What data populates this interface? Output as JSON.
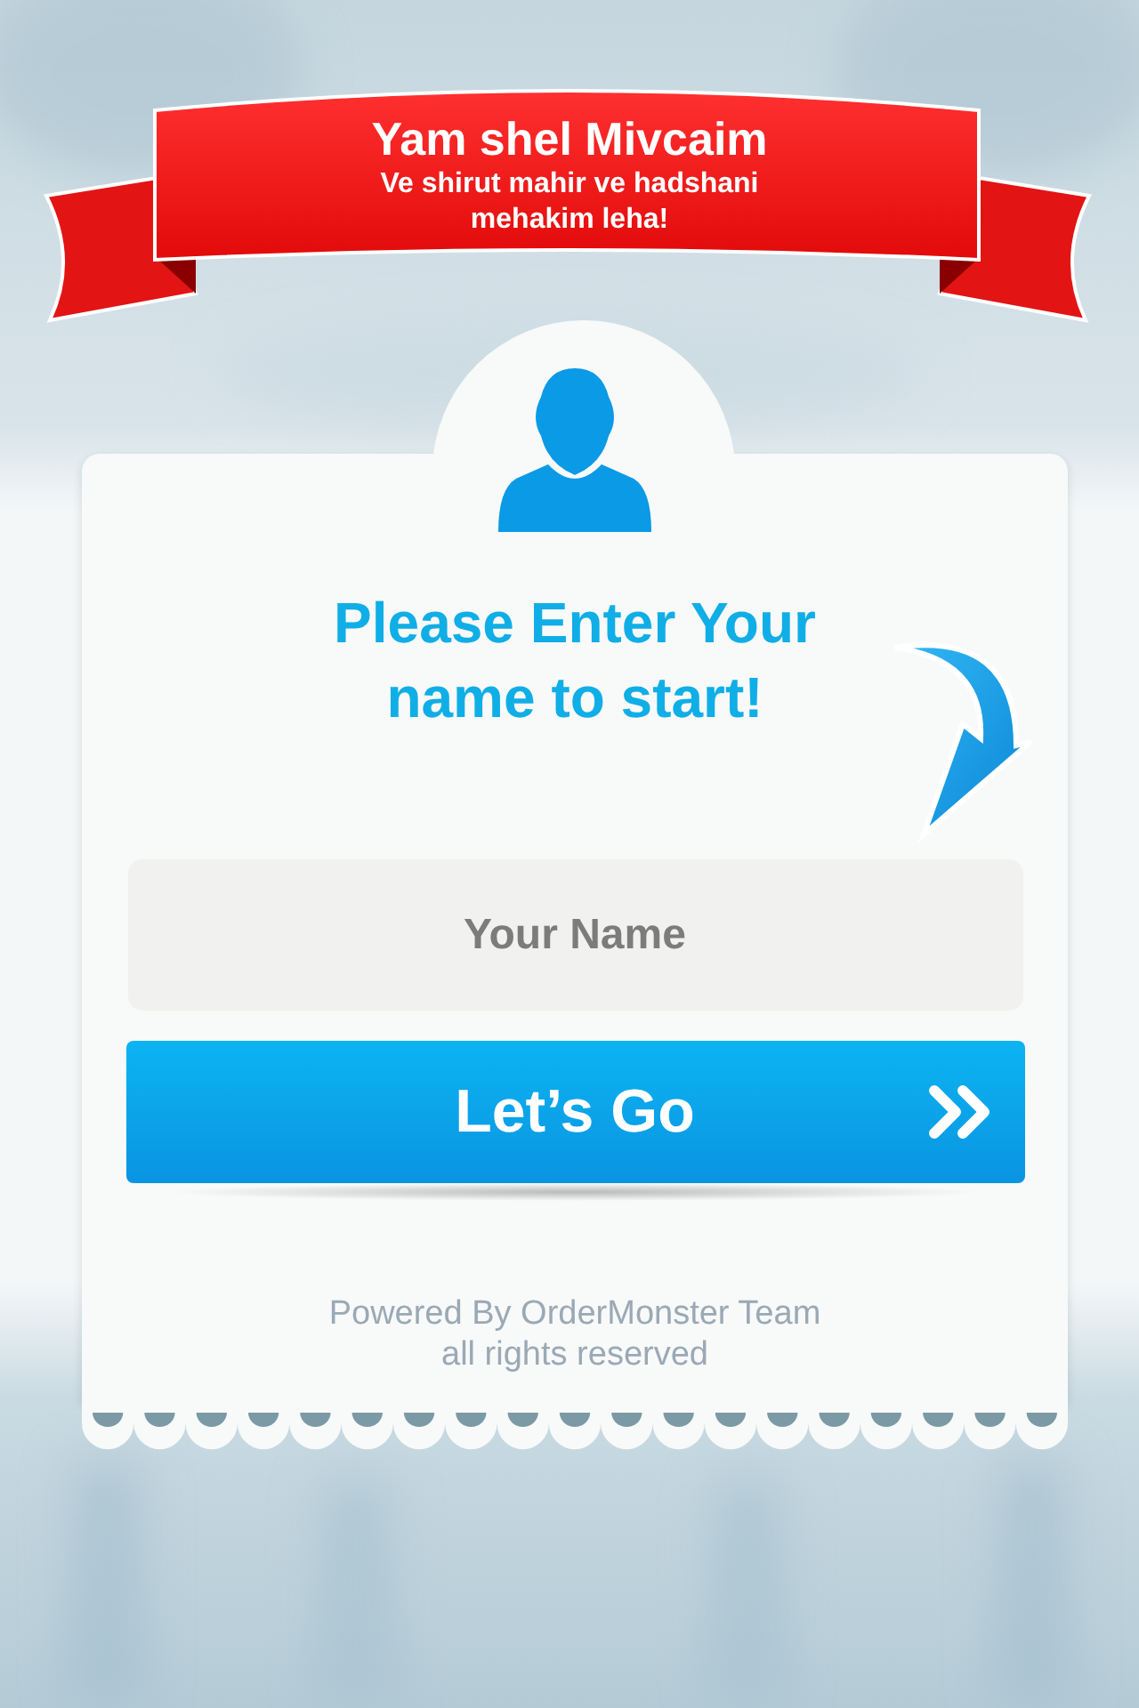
{
  "banner": {
    "title": "Yam shel Mivcaim",
    "subtitle": "Ve shirut mahir ve hadshani mehakim leha!"
  },
  "card": {
    "heading": "Please Enter Your name to start!",
    "name_field": {
      "placeholder": "Your Name"
    },
    "start_button": {
      "label": "Let’s Go"
    },
    "footer": [
      "Powered By OrderMonster Team",
      "all rights reserved"
    ]
  }
}
